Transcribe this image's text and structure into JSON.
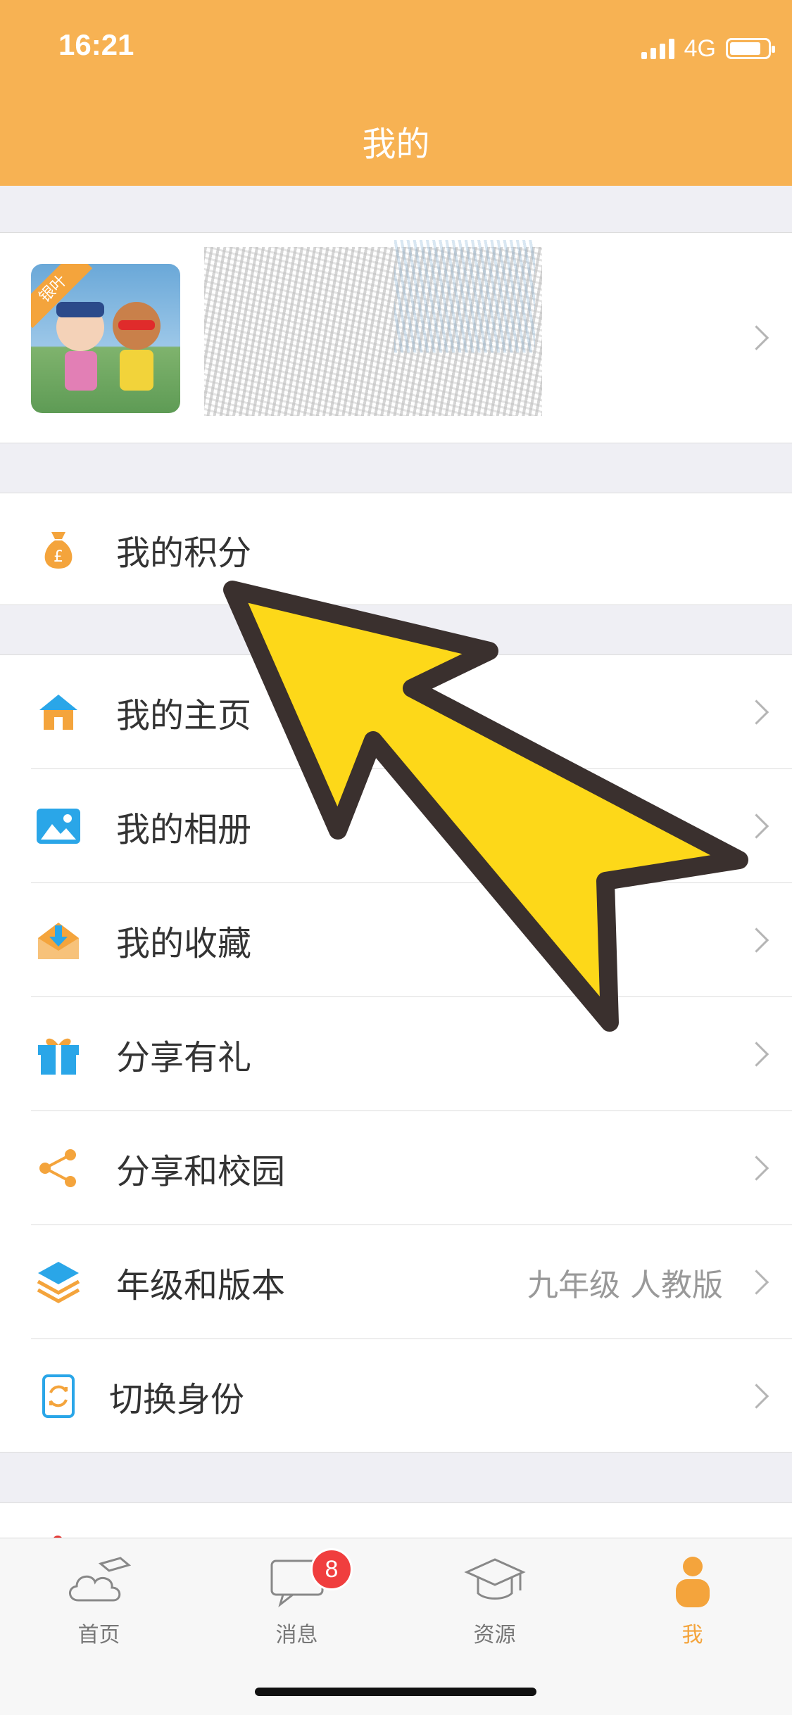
{
  "status_bar": {
    "time": "16:21",
    "network": "4G"
  },
  "header": {
    "title": "我的"
  },
  "profile": {
    "avatar_badge": "银叶"
  },
  "points_row": {
    "label": "我的积分",
    "icon": "money-bag-icon"
  },
  "menu": {
    "items": [
      {
        "label": "我的主页",
        "icon": "home-icon",
        "value": ""
      },
      {
        "label": "我的相册",
        "icon": "photo-album-icon",
        "value": ""
      },
      {
        "label": "我的收藏",
        "icon": "favorites-download-icon",
        "value": ""
      },
      {
        "label": "分享有礼",
        "icon": "gift-icon",
        "value": ""
      },
      {
        "label": "分享和校园",
        "icon": "share-icon",
        "value": ""
      },
      {
        "label": "年级和版本",
        "icon": "layers-icon",
        "value": "九年级 人教版"
      },
      {
        "label": "切换身份",
        "icon": "switch-identity-icon",
        "value": ""
      }
    ]
  },
  "tabbar": {
    "tabs": [
      {
        "label": "首页",
        "icon": "cloud-graduation-icon"
      },
      {
        "label": "消息",
        "icon": "chat-bubble-icon",
        "badge": "8"
      },
      {
        "label": "资源",
        "icon": "graduation-cap-icon"
      },
      {
        "label": "我",
        "icon": "person-icon"
      }
    ]
  },
  "colors": {
    "accent": "#f7b253",
    "active_tab": "#f4a43c",
    "badge": "#f03e3e",
    "arrow_fill": "#fdd819",
    "arrow_stroke": "#3a302e"
  }
}
